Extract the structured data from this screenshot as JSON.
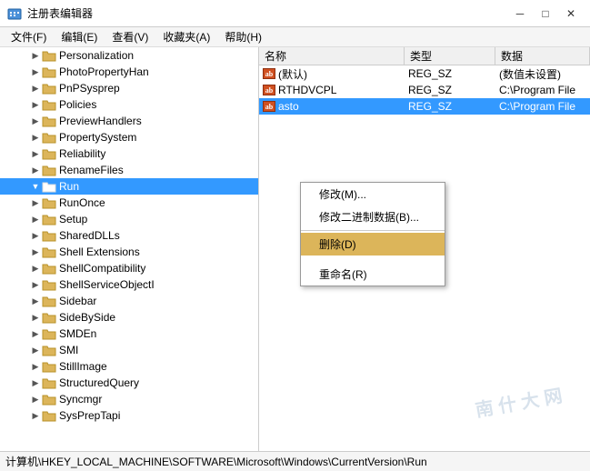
{
  "window": {
    "title": "注册表编辑器",
    "title_icon": "regedit-icon"
  },
  "titlebar": {
    "minimize_label": "─",
    "maximize_label": "□",
    "close_label": "✕"
  },
  "menubar": {
    "items": [
      {
        "label": "文件(F)"
      },
      {
        "label": "编辑(E)"
      },
      {
        "label": "查看(V)"
      },
      {
        "label": "收藏夹(A)"
      },
      {
        "label": "帮助(H)"
      }
    ]
  },
  "tree": {
    "items": [
      {
        "label": "Personalization",
        "indent": 1,
        "expanded": false
      },
      {
        "label": "PhotoPropertyHan",
        "indent": 1,
        "expanded": false
      },
      {
        "label": "PnPSysprep",
        "indent": 1,
        "expanded": false
      },
      {
        "label": "Policies",
        "indent": 1,
        "expanded": false
      },
      {
        "label": "PreviewHandlers",
        "indent": 1,
        "expanded": false
      },
      {
        "label": "PropertySystem",
        "indent": 1,
        "expanded": false
      },
      {
        "label": "Reliability",
        "indent": 1,
        "expanded": false
      },
      {
        "label": "RenameFiles",
        "indent": 1,
        "expanded": false
      },
      {
        "label": "Run",
        "indent": 1,
        "expanded": true,
        "selected": true
      },
      {
        "label": "RunOnce",
        "indent": 1,
        "expanded": false
      },
      {
        "label": "Setup",
        "indent": 1,
        "expanded": false
      },
      {
        "label": "SharedDLLs",
        "indent": 1,
        "expanded": false
      },
      {
        "label": "Shell Extensions",
        "indent": 1,
        "expanded": false
      },
      {
        "label": "ShellCompatibility",
        "indent": 1,
        "expanded": false
      },
      {
        "label": "ShellServiceObjectI",
        "indent": 1,
        "expanded": false
      },
      {
        "label": "Sidebar",
        "indent": 1,
        "expanded": false
      },
      {
        "label": "SideBySide",
        "indent": 1,
        "expanded": false
      },
      {
        "label": "SMDEn",
        "indent": 1,
        "expanded": false
      },
      {
        "label": "SMI",
        "indent": 1,
        "expanded": false
      },
      {
        "label": "StillImage",
        "indent": 1,
        "expanded": false
      },
      {
        "label": "StructuredQuery",
        "indent": 1,
        "expanded": false
      },
      {
        "label": "Syncmgr",
        "indent": 1,
        "expanded": false
      },
      {
        "label": "SysPrepTapi",
        "indent": 1,
        "expanded": false
      }
    ]
  },
  "table": {
    "headers": [
      {
        "label": "名称",
        "key": "name"
      },
      {
        "label": "类型",
        "key": "type"
      },
      {
        "label": "数据",
        "key": "data"
      }
    ],
    "rows": [
      {
        "name": "(默认)",
        "type": "REG_SZ",
        "data": "(数值未设置)",
        "icon": "ab",
        "selected": false
      },
      {
        "name": "RTHDVCPL",
        "type": "REG_SZ",
        "data": "C:\\Program File",
        "icon": "ab",
        "selected": false
      },
      {
        "name": "asto",
        "type": "REG_SZ",
        "data": "C:\\Program File",
        "icon": "ab",
        "selected": true
      }
    ]
  },
  "context_menu": {
    "items": [
      {
        "label": "修改(M)...",
        "highlighted": false
      },
      {
        "label": "修改二进制数据(B)...",
        "highlighted": false
      },
      {
        "separator": true
      },
      {
        "label": "删除(D)",
        "highlighted": true
      },
      {
        "separator": false
      },
      {
        "label": "重命名(R)",
        "highlighted": false
      }
    ]
  },
  "status_bar": {
    "text": "计算机\\HKEY_LOCAL_MACHINE\\SOFTWARE\\Microsoft\\Windows\\CurrentVersion\\Run"
  },
  "watermark": {
    "line1": "南 什 大 网"
  }
}
